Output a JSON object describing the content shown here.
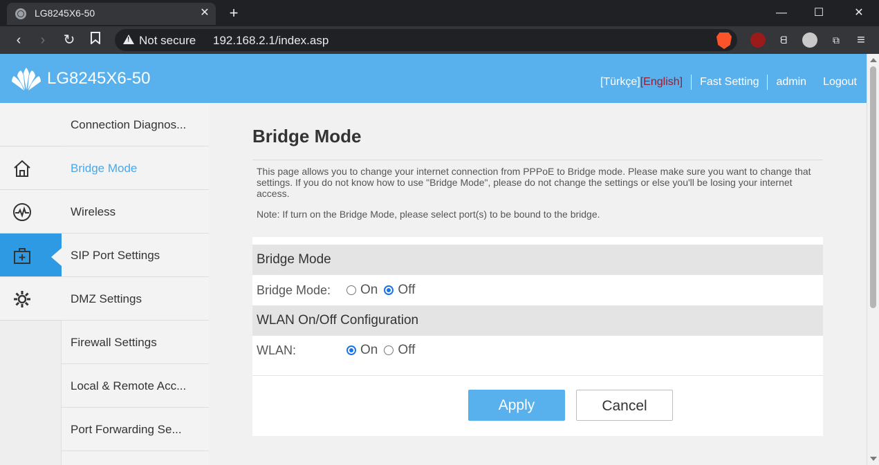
{
  "browser": {
    "tab_title": "LG8245X6-50",
    "tab_close": "✕",
    "new_tab": "+",
    "not_secure": "Not secure",
    "url": "192.168.2.1/index.asp",
    "window_controls": {
      "minimize": "—",
      "maximize": "☐",
      "close": "✕"
    }
  },
  "header": {
    "logo_text": "LG8245X6-50",
    "lang_tr": "[Türkçe]",
    "lang_en": "[English]",
    "fast_setting": "Fast Setting",
    "user": "admin",
    "logout": "Logout"
  },
  "sidebar_icons": [
    {
      "name": "blank",
      "active": false
    },
    {
      "name": "home-icon",
      "active": false
    },
    {
      "name": "pulse-icon",
      "active": false
    },
    {
      "name": "firstaid-icon",
      "active": true
    },
    {
      "name": "gear-icon",
      "active": false
    }
  ],
  "menu": {
    "items": [
      {
        "label": "Connection Diagnos..."
      },
      {
        "label": "Bridge Mode"
      },
      {
        "label": "Wireless"
      },
      {
        "label": "SIP Port Settings"
      },
      {
        "label": "DMZ Settings"
      },
      {
        "label": "Firewall Settings"
      },
      {
        "label": "Local & Remote Acc..."
      },
      {
        "label": "Port Forwarding Se..."
      }
    ],
    "active_index": 1
  },
  "content": {
    "title": "Bridge Mode",
    "description": "This page allows you to change your internet connection from PPPoE to Bridge mode. Please make sure you want to change that settings. If you do not know how to use \"Bridge Mode\", please do not change the settings or else you'll be losing your internet access.",
    "note": "Note: If turn on the Bridge Mode, please select port(s) to be bound to the bridge.",
    "section_bridge": "Bridge Mode",
    "bridge_label": "Bridge Mode:",
    "bridge_value": "Off",
    "section_wlan": "WLAN On/Off Configuration",
    "wlan_label": "WLAN:",
    "wlan_value": "On",
    "option_on": "On",
    "option_off": "Off",
    "apply": "Apply",
    "cancel": "Cancel"
  },
  "colors": {
    "header_bg": "#58b1ec",
    "active_icon_bg": "#2e9ae3",
    "active_menu_text": "#4aa8e8",
    "lang_active": "#9b1b30"
  }
}
